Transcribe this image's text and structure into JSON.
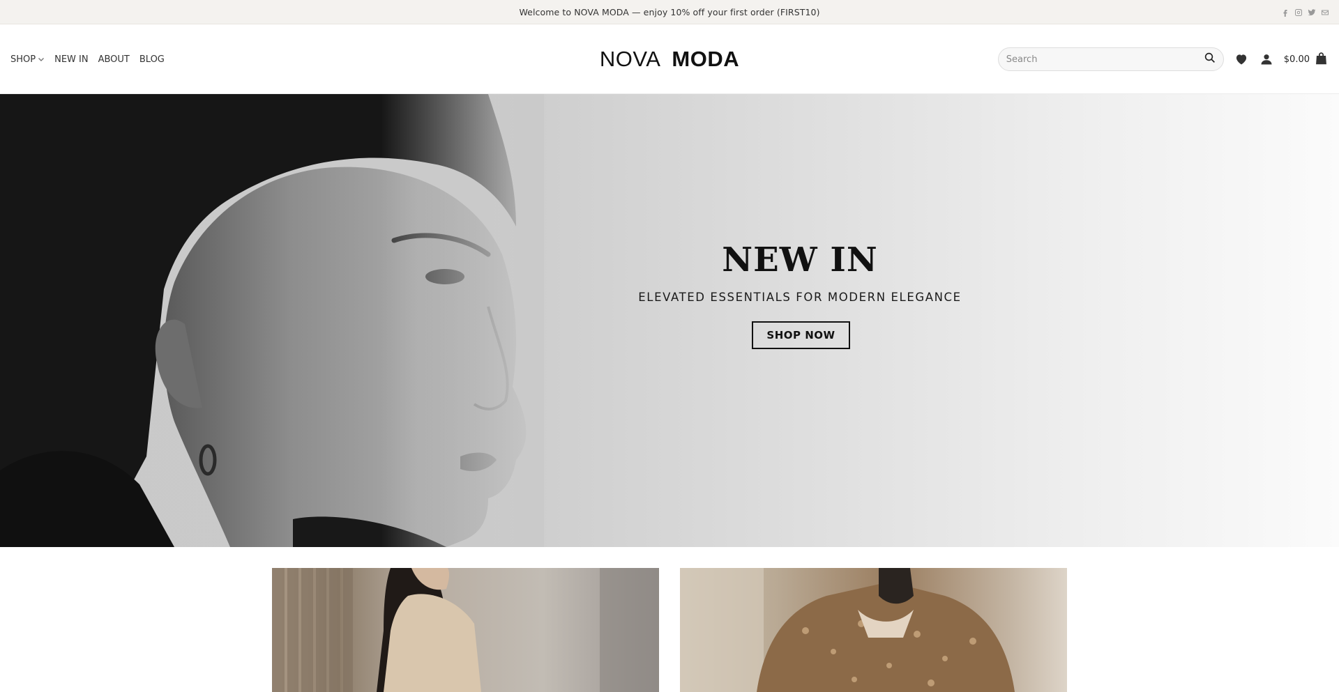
{
  "topbar": {
    "message": "Welcome to NOVA MODA — enjoy 10% off your first order (FIRST10)",
    "social_icons": [
      "facebook-icon",
      "instagram-icon",
      "twitter-icon",
      "mail-icon"
    ]
  },
  "nav": {
    "items": [
      {
        "label": "SHOP",
        "has_dropdown": true
      },
      {
        "label": "NEW IN"
      },
      {
        "label": "ABOUT"
      },
      {
        "label": "BLOG"
      }
    ]
  },
  "logo": {
    "light": "NOVA",
    "bold": "MODA"
  },
  "search": {
    "placeholder": "Search",
    "value": ""
  },
  "cart": {
    "total": "$0.00"
  },
  "icons": {
    "wishlist": "heart-icon",
    "account": "user-icon",
    "cart": "shopping-bag-icon",
    "search": "search-icon",
    "dropdown": "chevron-down-icon"
  },
  "hero": {
    "title": "NEW IN",
    "subtitle": "ELEVATED ESSENTIALS FOR MODERN ELEGANCE",
    "button_label": "SHOP NOW"
  },
  "colors": {
    "topbar_bg": "#f4f2ef",
    "text": "#111111",
    "hero_bg": "#cacaca"
  }
}
